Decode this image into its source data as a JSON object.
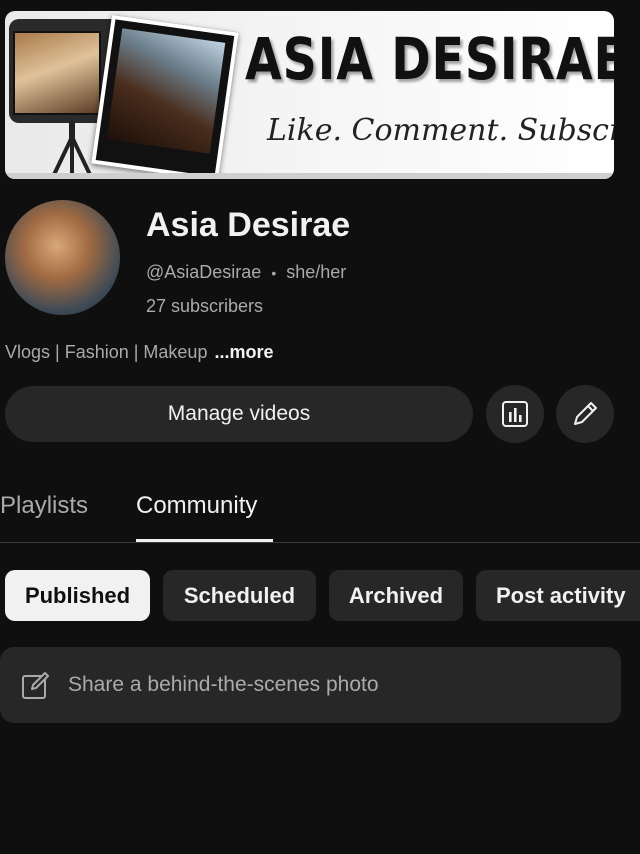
{
  "banner": {
    "title": "ASIA DESIRAE",
    "tagline": "Like. Comment. Subscribe!"
  },
  "channel": {
    "name": "Asia Desirae",
    "handle": "@AsiaDesirae",
    "separator": "•",
    "pronouns": "she/her",
    "subscribers": "27 subscribers",
    "description": "Vlogs | Fashion | Makeup",
    "more_label": "...more"
  },
  "actions": {
    "manage_videos": "Manage videos",
    "analytics_icon": "analytics-icon",
    "edit_icon": "pencil-icon"
  },
  "tabs": [
    {
      "label": "Playlists",
      "active": false
    },
    {
      "label": "Community",
      "active": true
    }
  ],
  "filters": [
    {
      "label": "Published",
      "active": true
    },
    {
      "label": "Scheduled",
      "active": false
    },
    {
      "label": "Archived",
      "active": false
    },
    {
      "label": "Post activity",
      "active": false
    }
  ],
  "composer": {
    "placeholder": "Share a behind-the-scenes photo",
    "icon": "edit-post-icon"
  },
  "colors": {
    "background": "#0f0f0f",
    "surface": "#272727",
    "text_primary": "#f1f1f1",
    "text_secondary": "#aaaaaa"
  }
}
